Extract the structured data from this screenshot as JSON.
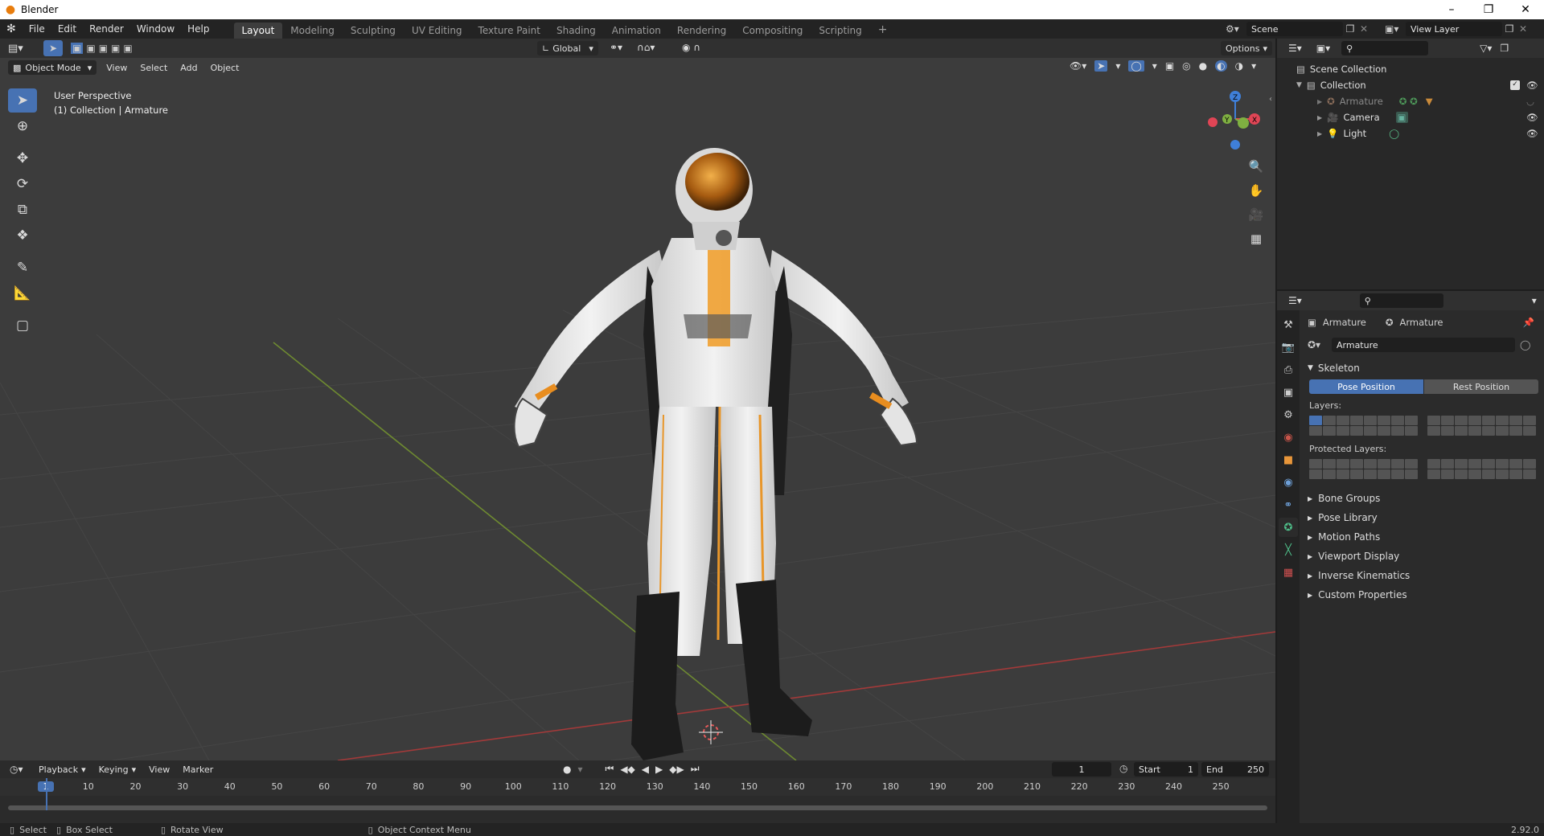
{
  "app": {
    "title": "Blender",
    "version": "2.92.0"
  },
  "menu": [
    "File",
    "Edit",
    "Render",
    "Window",
    "Help"
  ],
  "workspaces": [
    "Layout",
    "Modeling",
    "Sculpting",
    "UV Editing",
    "Texture Paint",
    "Shading",
    "Animation",
    "Rendering",
    "Compositing",
    "Scripting"
  ],
  "workspace_add": "+",
  "scene_field": "Scene",
  "view_layer_field": "View Layer",
  "viewport": {
    "transform_orientation": "Global",
    "options_label": "Options",
    "mode": "Object Mode",
    "header_menus": [
      "View",
      "Select",
      "Add",
      "Object"
    ],
    "overlay_line1": "User Perspective",
    "overlay_line2": "(1) Collection | Armature",
    "gizmo": {
      "x": "X",
      "y": "Y",
      "z": "Z"
    }
  },
  "timeline": {
    "menus": [
      "Playback",
      "Keying",
      "View",
      "Marker"
    ],
    "current_frame": "1",
    "start_label": "Start",
    "start_value": "1",
    "end_label": "End",
    "end_value": "250",
    "ruler": [
      "1",
      "10",
      "20",
      "30",
      "40",
      "50",
      "60",
      "70",
      "80",
      "90",
      "100",
      "110",
      "120",
      "130",
      "140",
      "150",
      "160",
      "170",
      "180",
      "190",
      "200",
      "210",
      "220",
      "230",
      "240",
      "250"
    ]
  },
  "outliner": {
    "scene_collection": "Scene Collection",
    "collection": "Collection",
    "items": [
      "Armature",
      "Camera",
      "Light"
    ]
  },
  "properties": {
    "breadcrumb_object": "Armature",
    "breadcrumb_data": "Armature",
    "data_name": "Armature",
    "skeleton_label": "Skeleton",
    "pose_position": "Pose Position",
    "rest_position": "Rest Position",
    "layers_label": "Layers:",
    "protected_layers_label": "Protected Layers:",
    "panels": [
      "Bone Groups",
      "Pose Library",
      "Motion Paths",
      "Viewport Display",
      "Inverse Kinematics",
      "Custom Properties"
    ]
  },
  "statusbar": {
    "select": "Select",
    "box_select": "Box Select",
    "rotate_view": "Rotate View",
    "context_menu": "Object Context Menu"
  },
  "colors": {
    "accent": "#4772b3",
    "orange": "#e87d0d",
    "x_axis": "#e04555",
    "y_axis": "#7fb041",
    "z_axis": "#3f7fd8"
  }
}
